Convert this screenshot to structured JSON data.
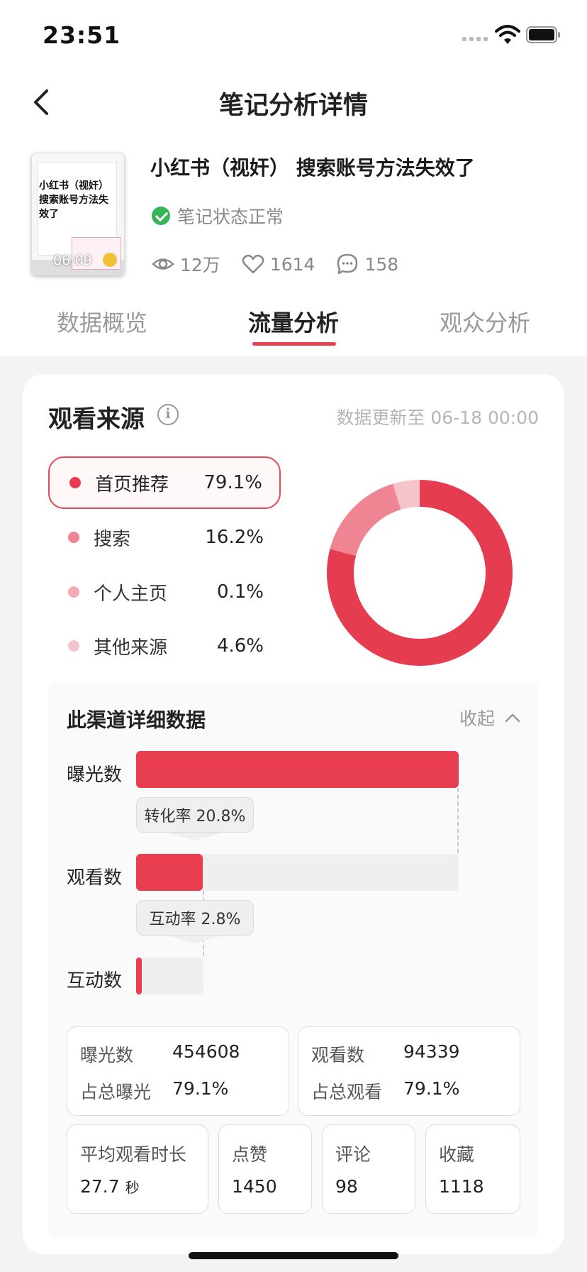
{
  "status_bar": {
    "time": "23:51"
  },
  "nav": {
    "title": "笔记分析详情"
  },
  "note": {
    "title": "小红书（视奸） 搜索账号方法失效了",
    "thumbnail_text": "小红书（视奸）搜索账号方法失效了",
    "duration": "06:09",
    "status": "笔记状态正常",
    "views": "12万",
    "likes": "1614",
    "comments": "158"
  },
  "tabs": [
    {
      "label": "数据概览",
      "active": false
    },
    {
      "label": "流量分析",
      "active": true
    },
    {
      "label": "观众分析",
      "active": false
    }
  ],
  "source_card": {
    "title": "观看来源",
    "update_time": "数据更新至 06-18 00:00",
    "sources": [
      {
        "label": "首页推荐",
        "value": "79.1%",
        "color": "#e63c4f",
        "selected": true
      },
      {
        "label": "搜索",
        "value": "16.2%",
        "color": "#ef8592",
        "selected": false
      },
      {
        "label": "个人主页",
        "value": "0.1%",
        "color": "#f2aab3",
        "selected": false
      },
      {
        "label": "其他来源",
        "value": "4.6%",
        "color": "#f5c4ca",
        "selected": false
      }
    ]
  },
  "chart_data": {
    "type": "pie",
    "categories": [
      "首页推荐",
      "搜索",
      "个人主页",
      "其他来源"
    ],
    "values": [
      79.1,
      16.2,
      0.1,
      4.6
    ],
    "colors": [
      "#e63c4f",
      "#ef8592",
      "#f2aab3",
      "#f5c4ca"
    ]
  },
  "channel_detail": {
    "title": "此渠道详细数据",
    "collapse_label": "收起",
    "funnel": {
      "exposure_label": "曝光数",
      "view_label": "观看数",
      "interaction_label": "互动数",
      "conversion_tag": "转化率 20.8%",
      "interaction_tag": "互动率 2.8%",
      "exposure_value": 454608,
      "view_value": 94339,
      "interaction_rate": 2.8
    },
    "metrics": {
      "exposure": {
        "label": "曝光数",
        "value": "454608"
      },
      "exposure_share": {
        "label": "占总曝光",
        "value": "79.1%"
      },
      "views": {
        "label": "观看数",
        "value": "94339"
      },
      "views_share": {
        "label": "占总观看",
        "value": "79.1%"
      },
      "avg_watch": {
        "label": "平均观看时长",
        "value": "27.7",
        "unit": "秒"
      },
      "likes": {
        "label": "点赞",
        "value": "1450"
      },
      "comments": {
        "label": "评论",
        "value": "98"
      },
      "favorites": {
        "label": "收藏",
        "value": "1118"
      }
    }
  }
}
